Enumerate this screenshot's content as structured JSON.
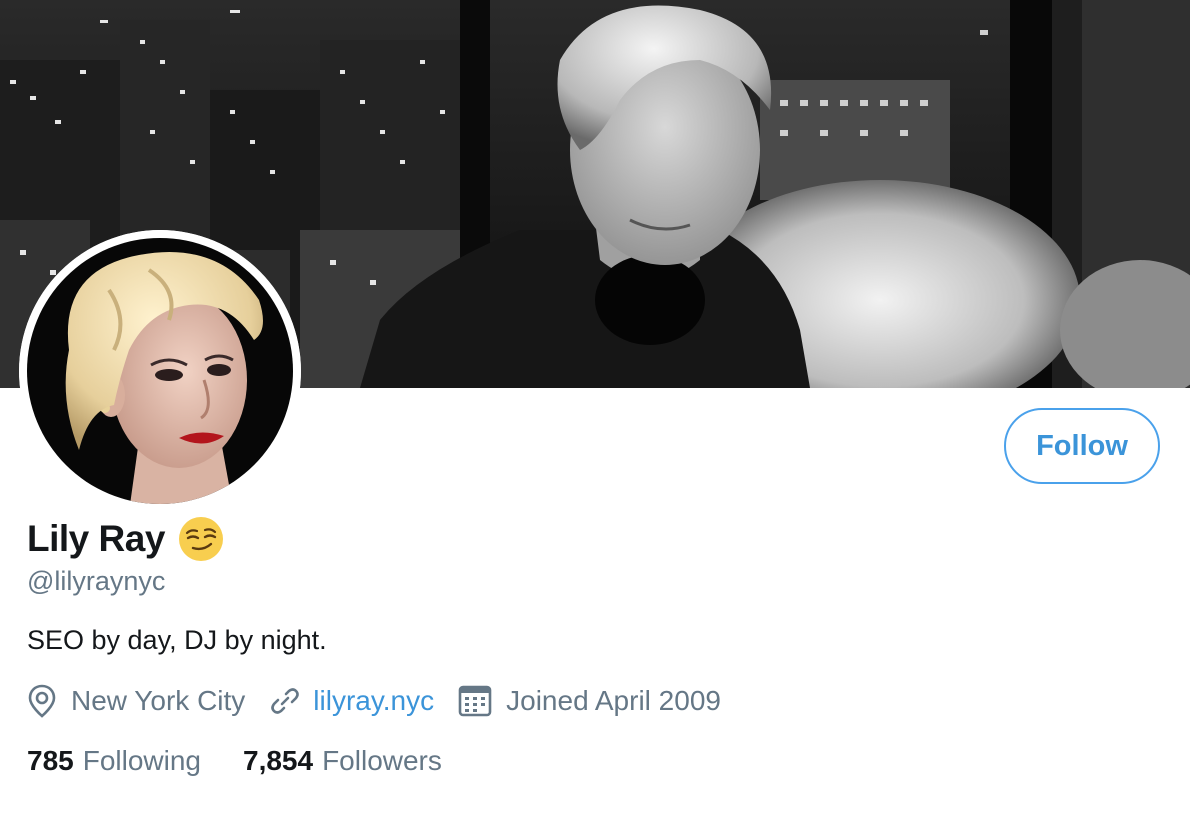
{
  "profile": {
    "display_name": "Lily Ray",
    "name_emoji": "smirking-face",
    "handle": "@lilyraynyc",
    "bio": "SEO by day, DJ by night.",
    "location": "New York City",
    "website": "lilyray.nyc",
    "joined": "Joined April 2009"
  },
  "stats": {
    "following_count": "785",
    "following_label": "Following",
    "followers_count": "7,854",
    "followers_label": "Followers"
  },
  "actions": {
    "follow_label": "Follow"
  },
  "icons": {
    "location": "location-pin-icon",
    "link": "link-icon",
    "calendar": "calendar-icon"
  },
  "colors": {
    "accent": "#3b94d9",
    "text_primary": "#14171a",
    "text_secondary": "#657786"
  }
}
